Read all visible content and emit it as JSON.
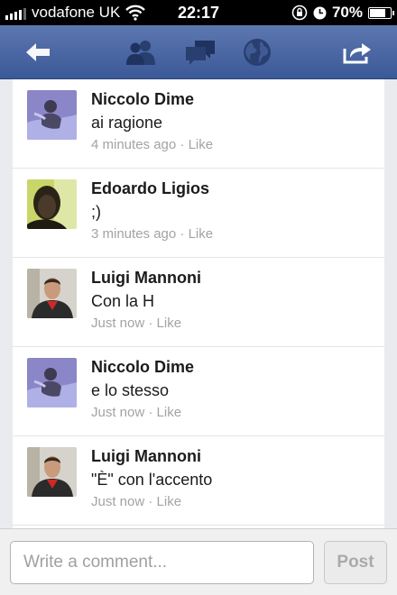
{
  "status_bar": {
    "carrier": "vodafone UK",
    "time": "22:17",
    "battery": "70%",
    "battery_level": 0.7,
    "icons": [
      "signal-icon",
      "wifi-icon",
      "rotation-lock-icon",
      "clock-icon",
      "battery-icon"
    ]
  },
  "nav": {
    "icons": [
      "back-arrow-icon",
      "friends-icon",
      "messages-icon",
      "globe-icon",
      "share-icon"
    ],
    "color": "#3b5998"
  },
  "comments": [
    {
      "name": "Niccolo Dime",
      "text": "ai ragione",
      "time": "4 minutes ago",
      "like": "Like"
    },
    {
      "name": "Edoardo Ligios",
      "text": ";)",
      "time": "3 minutes ago",
      "like": "Like"
    },
    {
      "name": "Luigi Mannoni",
      "text": "Con la H",
      "time": "Just now",
      "like": "Like"
    },
    {
      "name": "Niccolo Dime",
      "text": "e lo stesso",
      "time": "Just now",
      "like": "Like"
    },
    {
      "name": "Luigi Mannoni",
      "text": "\"È\" con l'accento",
      "time": "Just now",
      "like": "Like"
    }
  ],
  "composer": {
    "placeholder": "Write a comment...",
    "post_label": "Post"
  }
}
